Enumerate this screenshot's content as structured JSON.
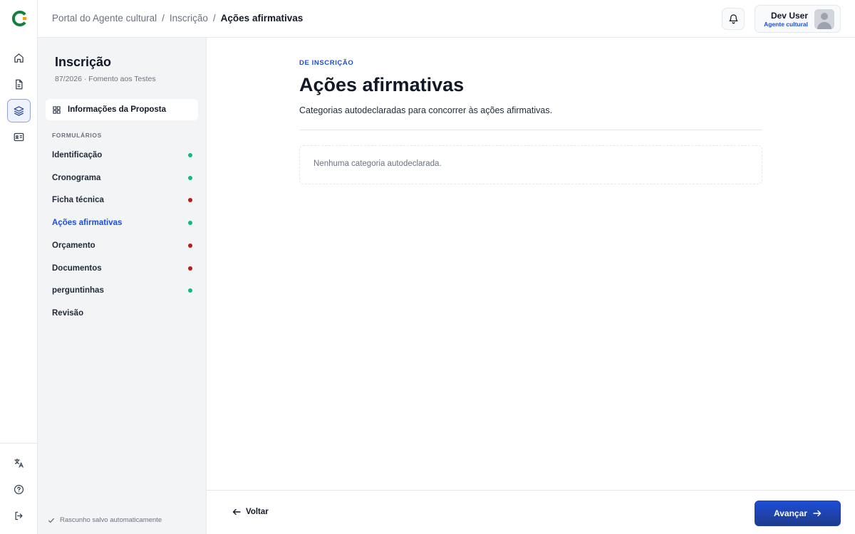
{
  "breadcrumb": {
    "items": [
      "Portal do Agente cultural",
      "Inscrição"
    ],
    "separator": "/",
    "current": "Ações afirmativas"
  },
  "user": {
    "name": "Dev User",
    "role": "Agente cultural"
  },
  "sidebar_icons": [
    "home-icon",
    "document-icon",
    "layers-icon",
    "id-card-icon",
    "translate-icon",
    "help-icon",
    "logout-icon"
  ],
  "form_sidebar": {
    "title": "Inscrição",
    "subtitle": "87/2026 · Fomento aos Testes",
    "info_button": "Informações da Proposta",
    "section_label": "FORMULÁRIOS",
    "items": [
      {
        "label": "Identificação",
        "status": "complete"
      },
      {
        "label": "Cronograma",
        "status": "complete"
      },
      {
        "label": "Ficha técnica",
        "status": "incomplete"
      },
      {
        "label": "Ações afirmativas",
        "status": "complete"
      },
      {
        "label": "Orçamento",
        "status": "incomplete"
      },
      {
        "label": "Documentos",
        "status": "incomplete"
      },
      {
        "label": "perguntinhas",
        "status": "complete"
      },
      {
        "label": "Revisão",
        "status": "none"
      }
    ],
    "active_item": "Ações afirmativas",
    "saved_text": "Rascunho salvo automaticamente"
  },
  "main": {
    "eyebrow": "DE INSCRIÇÃO",
    "title": "Ações afirmativas",
    "description": "Categorias autodeclaradas para concorrer às ações afirmativas.",
    "empty_message": "Nenhuma categoria autodeclarada."
  },
  "footer": {
    "back_label": "Voltar",
    "next_label": "Avançar"
  },
  "colors": {
    "accent": "#1d4ed8",
    "status_complete": "#10b981",
    "status_incomplete": "#b91c1c",
    "brand_green": "#15803d",
    "brand_orange": "#f59e0b"
  }
}
